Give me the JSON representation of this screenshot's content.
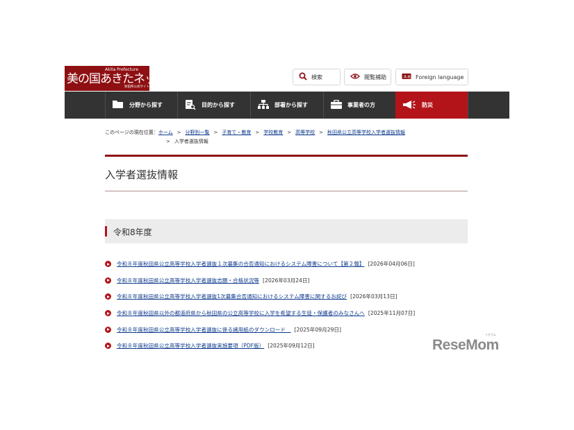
{
  "header": {
    "logo_main": "美の国あきたネット",
    "logo_en": "Akita Prefecture",
    "logo_sub": "秋田県公式サイト",
    "search_label": "検索",
    "accessibility_label": "閲覧補助",
    "language_label": "Foreign language"
  },
  "nav": {
    "items": [
      {
        "label": "分野から探す"
      },
      {
        "label": "目的から探す"
      },
      {
        "label": "部署から探す"
      },
      {
        "label": "事業者の方"
      },
      {
        "label": "防災"
      }
    ],
    "emergency_color": "#b3141a"
  },
  "breadcrumb": {
    "prefix": "このページの現在位置：",
    "links": [
      "ホーム",
      "分野別一覧",
      "子育て・教育",
      "学校教育",
      "高等学校",
      "秋田県公立高等学校入学者選抜情報"
    ],
    "separator": ">",
    "current": "入学者選抜情報"
  },
  "page": {
    "title": "入学者選抜情報",
    "section_heading": "令和8年度"
  },
  "articles": [
    {
      "title": "令和８年度秋田県公立高等学校入学者選抜１次募集の合否通知におけるシステム障害について【第２報】",
      "date": "[2026年04月06日]"
    },
    {
      "title": "令和８年度秋田県公立高等学校入学者選抜志願・合格状況等",
      "date": "[2026年03月24日]"
    },
    {
      "title": "令和８年度秋田県公立高等学校入学者選抜1次募集合否通知におけるシステム障害に関するお詫び",
      "date": "[2026年03月13日]"
    },
    {
      "title": "令和８年度秋田県以外の都道府県から秋田県の公立高等学校に入学を希望する生徒・保護者のみなさんへ",
      "date": "[2025年11月07日]"
    },
    {
      "title": "令和８年度秋田県公立高等学校入学者選抜に係る諸用紙のダウンロード　",
      "date": "[2025年09月29日]"
    },
    {
      "title": "令和８年度秋田県公立高等学校入学者選抜実施要項（PDF版）",
      "date": "[2025年09月12日]"
    }
  ],
  "watermark": {
    "text": "ReseMom",
    "kana": "リセマム"
  },
  "colors": {
    "brand": "#8e1012",
    "nav_bg": "#333333",
    "link": "#0d3a8c",
    "accent": "#b3141a"
  }
}
